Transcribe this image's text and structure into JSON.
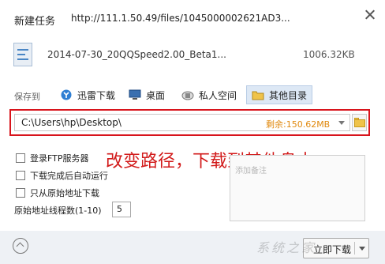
{
  "dialog": {
    "title": "新建任务",
    "url": "http://111.1.50.49/files/1045000002621AD3...",
    "close_icon": "close-icon"
  },
  "file": {
    "name": "2014-07-30_20QQSpeed2.00_Beta1...",
    "size": "1006.32KB",
    "icon": "file-icon"
  },
  "save_to": {
    "label": "保存到",
    "options": [
      {
        "label": "迅雷下载",
        "icon": "thunder-download-icon"
      },
      {
        "label": "桌面",
        "icon": "desktop-icon"
      },
      {
        "label": "私人空间",
        "icon": "private-space-icon"
      },
      {
        "label": "其他目录",
        "icon": "other-folder-icon",
        "active": true
      }
    ]
  },
  "path": {
    "value": "C:\\Users\\hp\\Desktop\\",
    "remaining": "剩余:150.62MB",
    "folder_icon": "folder-browse-icon"
  },
  "annotation": {
    "text": "改变路径，下载到其他盘中。",
    "color": "#d21a1a"
  },
  "options": {
    "login_ftp": "登录FTP服务器",
    "auto_run": "下载完成后自动运行",
    "origin_only": "只从原始地址下载",
    "threads_label": "原始地址线程数(1-10)",
    "threads_value": "5"
  },
  "notes": {
    "placeholder": "添加备注"
  },
  "footer": {
    "download_label": "立即下载",
    "watermark": "系统之家"
  },
  "colors": {
    "highlight_border": "#d8141c",
    "remaining_text": "#e0890e",
    "active_option_bg": "#dde8f5"
  }
}
